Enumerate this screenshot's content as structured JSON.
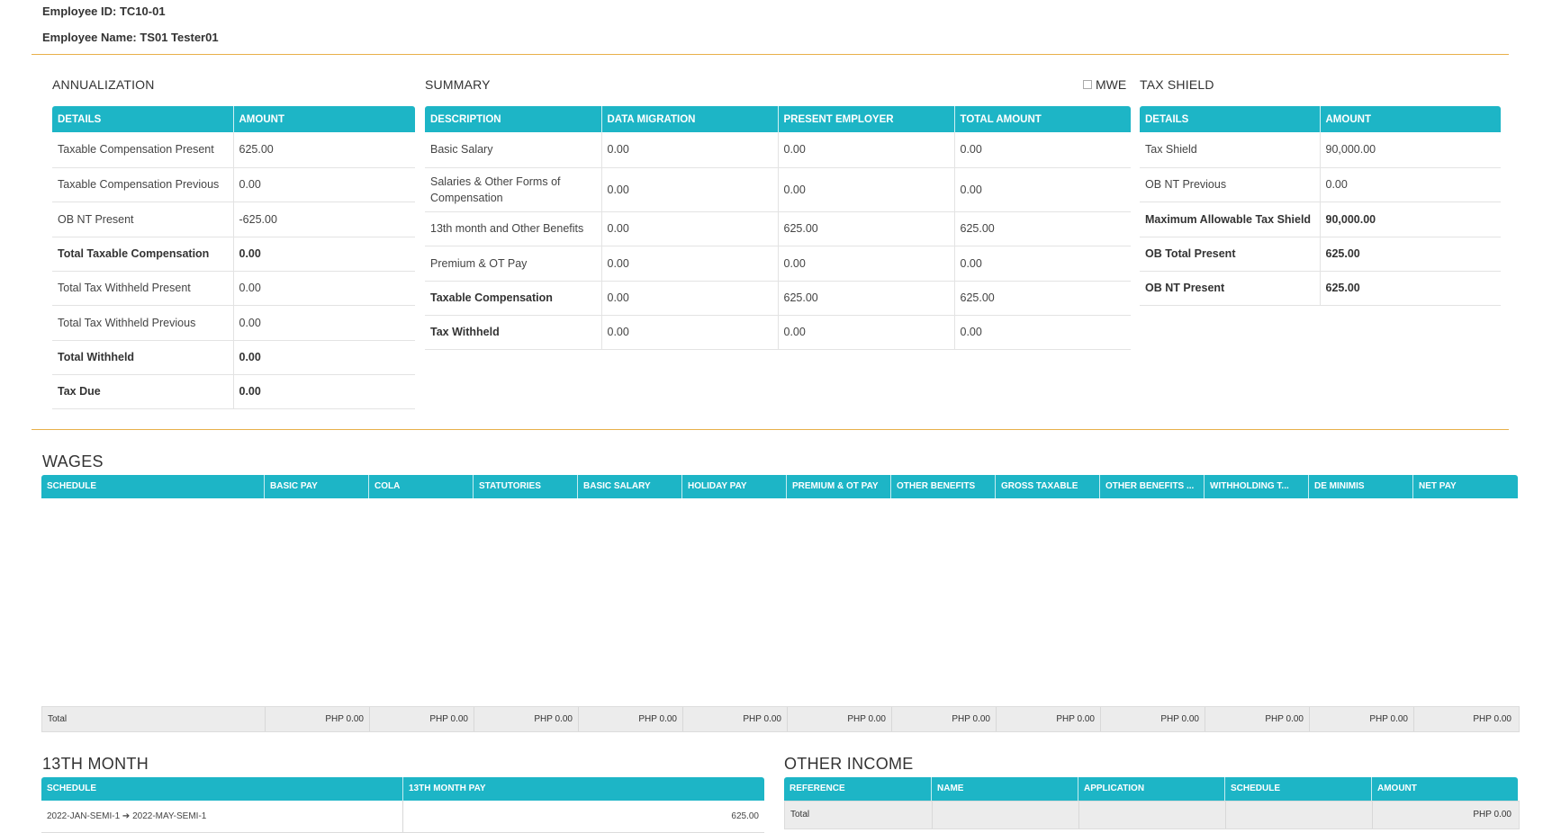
{
  "employee": {
    "id_label": "Employee ID: TC10-01",
    "name_label": "Employee Name: TS01 Tester01"
  },
  "annualization": {
    "title": "ANNUALIZATION",
    "headers": [
      "DETAILS",
      "AMOUNT"
    ],
    "rows": [
      {
        "label": "Taxable Compensation Present",
        "value": "625.00",
        "bold": false
      },
      {
        "label": "Taxable Compensation Previous",
        "value": "0.00",
        "bold": false
      },
      {
        "label": "OB NT Present",
        "value": "-625.00",
        "bold": false
      },
      {
        "label": "Total Taxable Compensation",
        "value": "0.00",
        "bold": true
      },
      {
        "label": "Total Tax Withheld Present",
        "value": "0.00",
        "bold": false
      },
      {
        "label": "Total Tax Withheld Previous",
        "value": "0.00",
        "bold": false
      },
      {
        "label": "Total Withheld",
        "value": "0.00",
        "bold": true
      },
      {
        "label": "Tax Due",
        "value": "0.00",
        "bold": true
      }
    ]
  },
  "summary": {
    "title": "SUMMARY",
    "mwe_label": "MWE",
    "headers": [
      "DESCRIPTION",
      "DATA MIGRATION",
      "PRESENT EMPLOYER",
      "TOTAL AMOUNT"
    ],
    "rows": [
      {
        "label": "Basic Salary",
        "data_migration": "0.00",
        "present": "0.00",
        "total": "0.00",
        "bold": false
      },
      {
        "label": "Salaries & Other Forms of Compensation",
        "data_migration": "0.00",
        "present": "0.00",
        "total": "0.00",
        "bold": false
      },
      {
        "label": "13th month and Other Benefits",
        "data_migration": "0.00",
        "present": "625.00",
        "total": "625.00",
        "bold": false
      },
      {
        "label": "Premium & OT Pay",
        "data_migration": "0.00",
        "present": "0.00",
        "total": "0.00",
        "bold": false
      },
      {
        "label": "Taxable Compensation",
        "data_migration": "0.00",
        "present": "625.00",
        "total": "625.00",
        "bold": true
      },
      {
        "label": "Tax Withheld",
        "data_migration": "0.00",
        "present": "0.00",
        "total": "0.00",
        "bold": true
      }
    ]
  },
  "tax_shield": {
    "title": "TAX SHIELD",
    "headers": [
      "DETAILS",
      "AMOUNT"
    ],
    "rows": [
      {
        "label": "Tax Shield",
        "value": "90,000.00",
        "bold": false
      },
      {
        "label": "OB NT Previous",
        "value": "0.00",
        "bold": false
      },
      {
        "label": "Maximum Allowable Tax Shield",
        "value": "90,000.00",
        "bold": true
      },
      {
        "label": "OB Total Present",
        "value": "625.00",
        "bold": true
      },
      {
        "label": "OB NT Present",
        "value": "625.00",
        "bold": true
      }
    ]
  },
  "wages": {
    "title": "WAGES",
    "columns": [
      "SCHEDULE",
      "BASIC PAY",
      "COLA",
      "STATUTORIES",
      "BASIC SALARY",
      "HOLIDAY PAY",
      "PREMIUM & OT PAY",
      "OTHER BENEFITS",
      "GROSS TAXABLE",
      "OTHER BENEFITS ...",
      "WITHHOLDING T...",
      "DE MINIMIS",
      "NET PAY"
    ],
    "total_label": "Total",
    "totals": [
      "PHP 0.00",
      "PHP 0.00",
      "PHP 0.00",
      "PHP 0.00",
      "PHP 0.00",
      "PHP 0.00",
      "PHP 0.00",
      "PHP 0.00",
      "PHP 0.00",
      "PHP 0.00",
      "PHP 0.00",
      "PHP 0.00"
    ]
  },
  "thirteenth_month": {
    "title": "13TH MONTH",
    "columns": [
      "SCHEDULE",
      "13TH MONTH PAY"
    ],
    "rows": [
      {
        "schedule": "2022-JAN-SEMI-1 ➔ 2022-MAY-SEMI-1",
        "pay": "625.00"
      }
    ]
  },
  "other_income": {
    "title": "OTHER INCOME",
    "columns": [
      "REFERENCE",
      "NAME",
      "APPLICATION",
      "SCHEDULE",
      "AMOUNT"
    ],
    "total_label": "Total",
    "total_amount": "PHP 0.00"
  }
}
